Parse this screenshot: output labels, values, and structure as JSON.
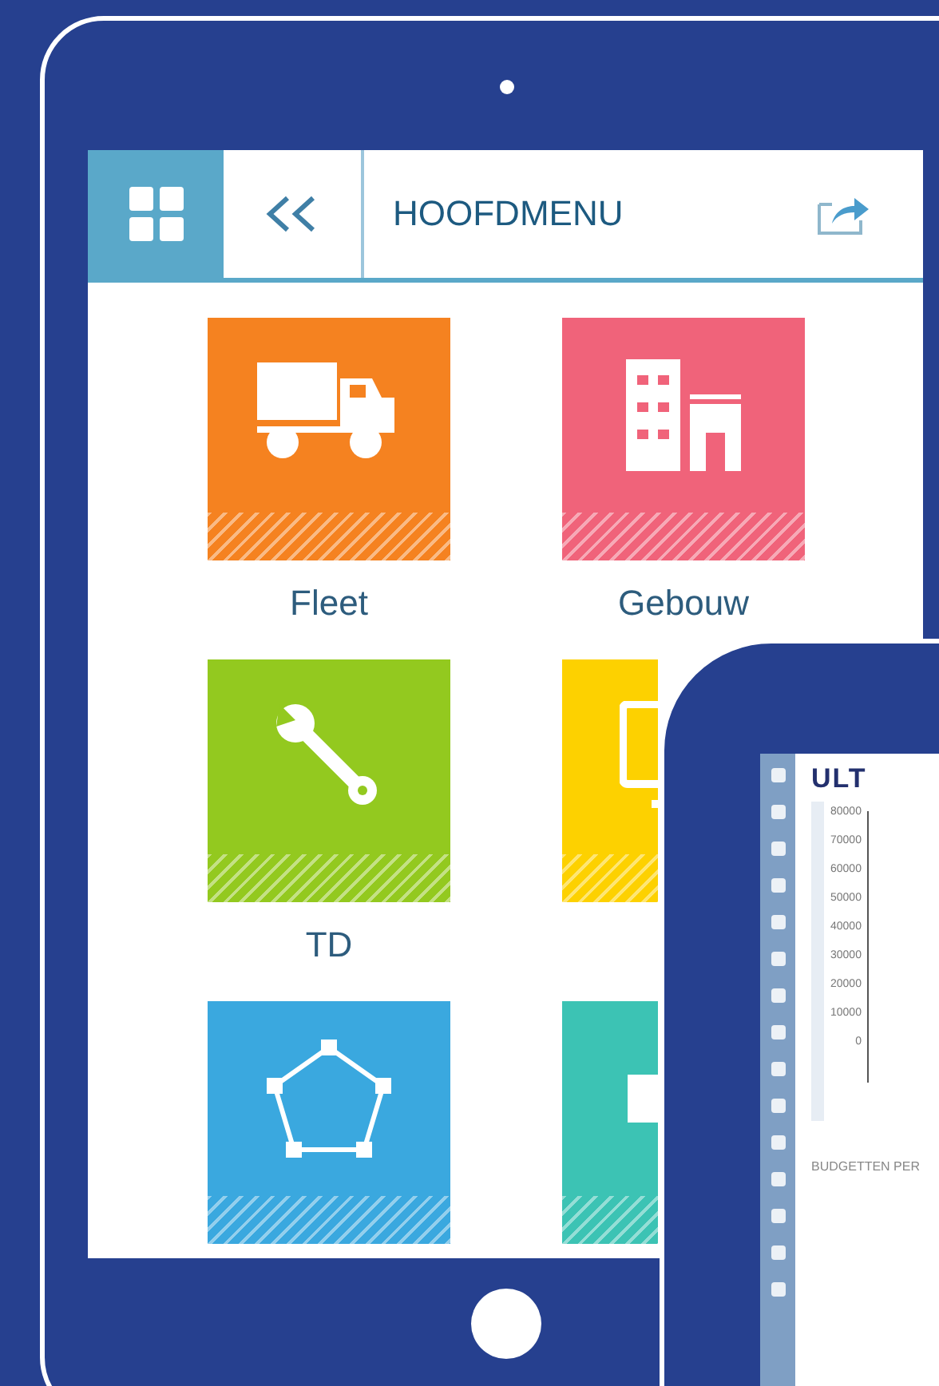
{
  "header": {
    "title": "HOOFDMENU"
  },
  "tiles": [
    {
      "label": "Fleet",
      "kind": "truck",
      "color": "#f58220",
      "partly_hidden": false
    },
    {
      "label": "Gebouw",
      "kind": "building",
      "color": "#f0637a",
      "partly_hidden": false
    },
    {
      "label": "TD",
      "kind": "wrench",
      "color": "#93c91f",
      "partly_hidden": false
    },
    {
      "kind": "monitor",
      "color": "#fdd100",
      "partly_hidden": true
    },
    {
      "kind": "pentagon",
      "color": "#3aa8df",
      "partly_hidden": false
    },
    {
      "kind": "block",
      "color": "#3cc3b4",
      "partly_hidden": true
    }
  ],
  "second_device": {
    "logo": "ULT",
    "y_axis_labels": [
      "80000",
      "70000",
      "60000",
      "50000",
      "40000",
      "30000",
      "20000",
      "10000",
      "0"
    ],
    "section_title": "BUDGETTEN PER"
  }
}
